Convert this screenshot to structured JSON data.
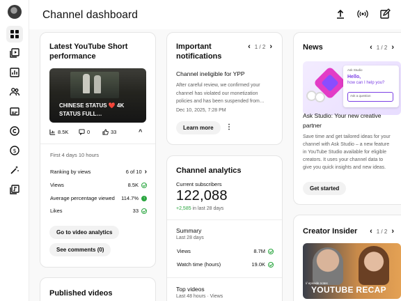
{
  "header": {
    "title": "Channel dashboard"
  },
  "short_card": {
    "title_line1": "Latest YouTube Short",
    "title_line2": "performance",
    "thumb_line1": "CHINESE STATUS ❤️ 4K",
    "thumb_line2": "STATUS FULL…",
    "views": "8.5K",
    "comments": "0",
    "likes": "33",
    "period": "First 4 days 10 hours",
    "rows": [
      {
        "label": "Ranking by views",
        "value": "6 of 10"
      },
      {
        "label": "Views",
        "value": "8.5K"
      },
      {
        "label": "Average percentage viewed",
        "value": "114.7%"
      },
      {
        "label": "Likes",
        "value": "33"
      }
    ],
    "analytics_btn": "Go to video analytics",
    "comments_btn": "See comments (0)"
  },
  "published": {
    "title": "Published videos"
  },
  "notifications": {
    "title_line1": "Important",
    "title_line2": "notifications",
    "pager": "1 / 2",
    "heading": "Channel ineligible for YPP",
    "body_lines": [
      "After careful review, we confirmed your",
      "channel has violated our monetization",
      "policies and has been suspended from…"
    ],
    "date": "Dec 10, 2025, 7:28 PM",
    "learn_more": "Learn more"
  },
  "analytics": {
    "title": "Channel analytics",
    "subs_label": "Current subscribers",
    "subs_value": "122,088",
    "subs_delta": "+2,585",
    "subs_delta_suffix": " in last 28 days",
    "summary_title": "Summary",
    "summary_sub": "Last 28 days",
    "rows": [
      {
        "label": "Views",
        "value": "8.7M"
      },
      {
        "label": "Watch time (hours)",
        "value": "19.0K"
      }
    ],
    "top_title": "Top videos",
    "top_sub": "Last 48 hours · Views"
  },
  "news": {
    "title": "News",
    "pager": "1 / 2",
    "img_brand": "Ask Studio",
    "img_hello": "Hello,",
    "img_help": "how can I help you?",
    "img_input": "Ask a question",
    "heading_line1": "Ask Studio: Your new creative",
    "heading_line2": "partner",
    "body_lines": [
      "Save time and get tailored ideas for your",
      "channel with Ask Studio – a new feature",
      "in YouTube Studio available for eligible",
      "creators. It uses your channel data to",
      "give you quick insights and new ideas."
    ],
    "cta": "Get started"
  },
  "creator_insider": {
    "title": "Creator Insider",
    "pager": "1 / 2",
    "thumb_small": "// episode notes",
    "thumb_big": "YOUTUBE RECAP"
  },
  "colors": {
    "accent_green": "#2ba640",
    "accent_purple": "#7b3fe4",
    "text_primary": "#0f0f0f",
    "text_secondary": "#606060"
  }
}
